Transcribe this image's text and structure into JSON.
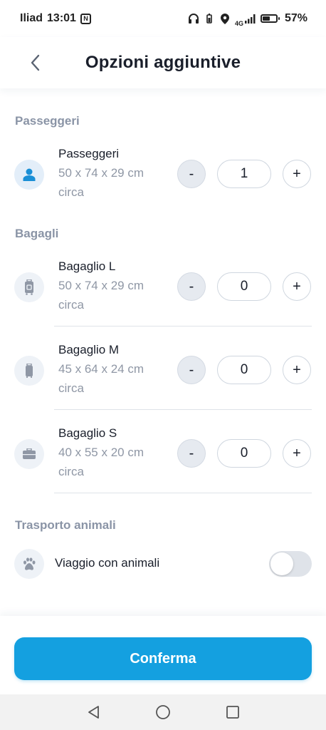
{
  "status_bar": {
    "carrier": "Iliad",
    "time": "13:01",
    "nfc": "N",
    "network": "4G",
    "battery_percent": "57%",
    "battery_level": 0.57
  },
  "header": {
    "title": "Opzioni aggiuntive",
    "back_icon": "chevron-left-icon"
  },
  "sections": {
    "passengers": {
      "title": "Passeggeri",
      "items": [
        {
          "name": "Passeggeri",
          "dimensions": "50 x 74 x 29 cm",
          "note": "circa",
          "value": "1",
          "icon": "person-icon"
        }
      ]
    },
    "luggage": {
      "title": "Bagagli",
      "items": [
        {
          "name": "Bagaglio L",
          "dimensions": "50 x 74 x 29 cm",
          "note": "circa",
          "value": "0",
          "icon": "suitcase-large-icon"
        },
        {
          "name": "Bagaglio M",
          "dimensions": "45 x 64 x 24 cm",
          "note": "circa",
          "value": "0",
          "icon": "suitcase-medium-icon"
        },
        {
          "name": "Bagaglio S",
          "dimensions": "40 x 55 x 20 cm",
          "note": "circa",
          "value": "0",
          "icon": "briefcase-icon"
        }
      ]
    },
    "pets": {
      "title": "Trasporto animali",
      "label": "Viaggio con animali",
      "enabled": false,
      "icon": "paw-icon"
    }
  },
  "stepper": {
    "minus": "-",
    "plus": "+"
  },
  "confirm_button": "Conferma",
  "colors": {
    "accent": "#14a0e0",
    "person_icon": "#1a8fd6",
    "muted": "#8f97a5"
  }
}
